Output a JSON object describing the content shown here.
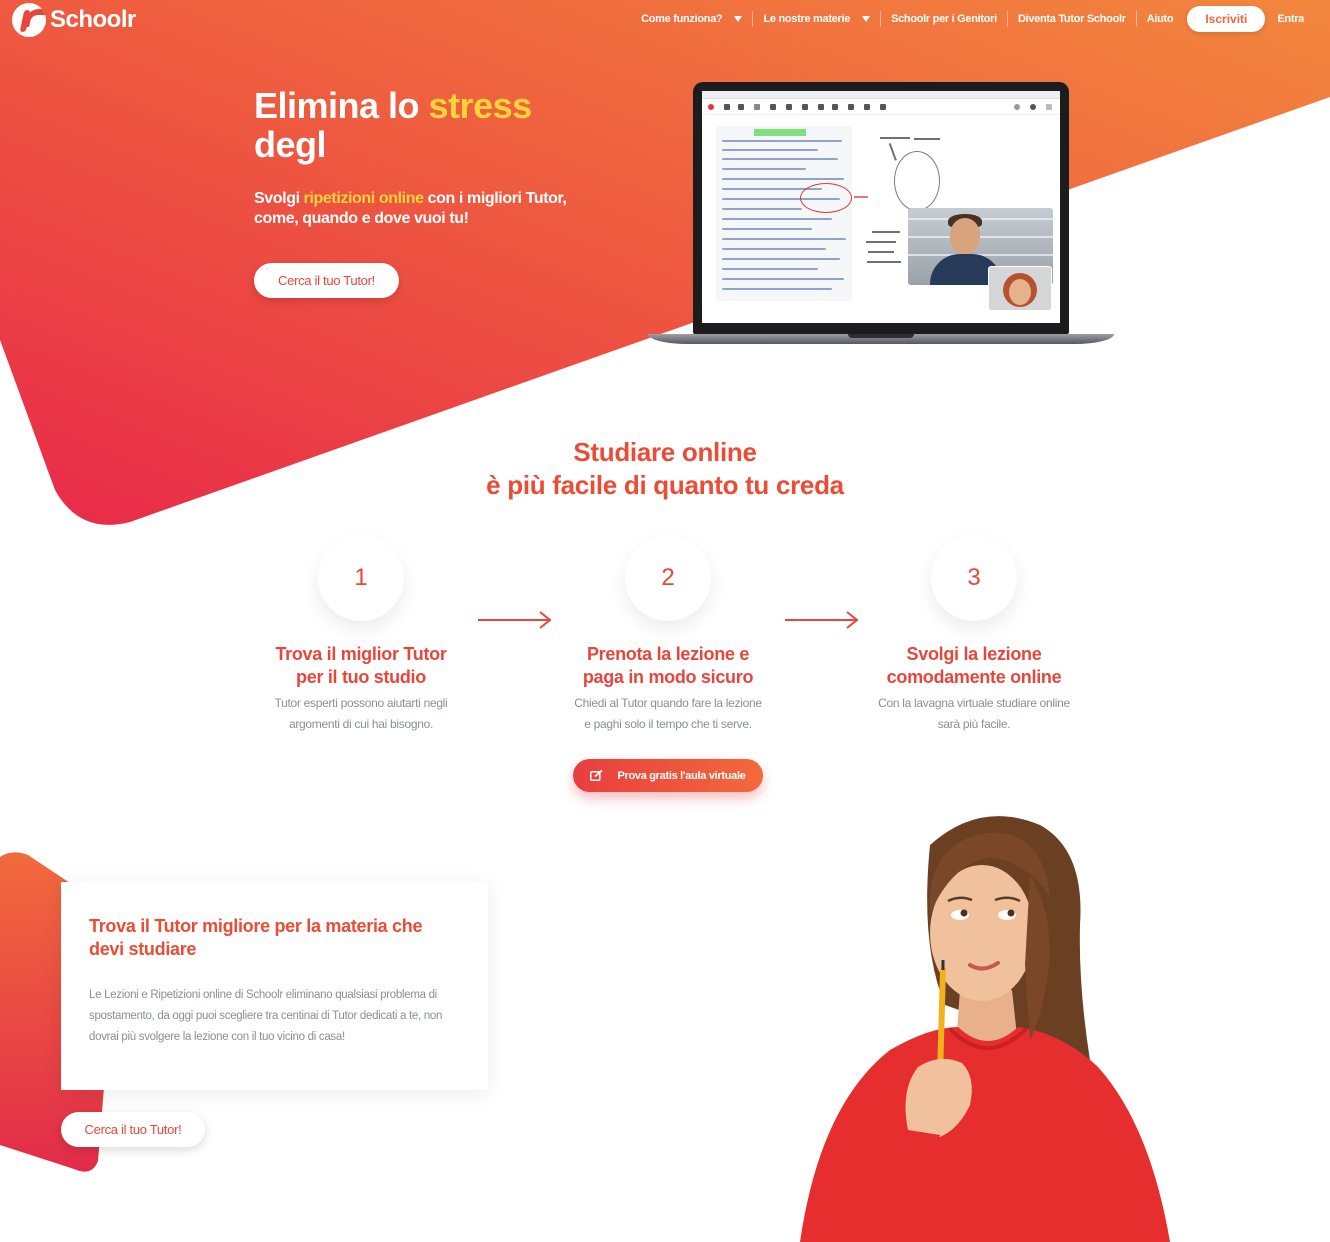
{
  "brand": {
    "name": "Schoolr"
  },
  "nav": {
    "items": [
      {
        "label": "Come funziona?",
        "dropdown": true
      },
      {
        "label": "Le nostre materie",
        "dropdown": true
      },
      {
        "label": "Schoolr per i Genitori",
        "dropdown": false
      },
      {
        "label": "Diventa Tutor Schoolr",
        "dropdown": false
      },
      {
        "label": "Aiuto",
        "dropdown": false
      }
    ],
    "signup": "Iscriviti",
    "login": "Entra"
  },
  "hero": {
    "title_part1": "Elimina lo ",
    "title_highlight": "stress",
    "title_part2": "degl",
    "subtitle_part1": "Svolgi ",
    "subtitle_highlight": "ripetizioni online",
    "subtitle_part2": " con i migliori Tutor, come, quando e dove vuoi tu!",
    "button": "Cerca il tuo Tutor!"
  },
  "steps_section": {
    "title_line1": "Studiare online",
    "title_line2": "è più facile di quanto tu creda",
    "steps": [
      {
        "number": "1",
        "title_line1": "Trova il miglior Tutor",
        "title_line2": "per il tuo studio",
        "text_line1": "Tutor esperti possono aiutarti negli",
        "text_line2": "argomenti di cui hai bisogno."
      },
      {
        "number": "2",
        "title_line1": "Prenota la lezione e",
        "title_line2": "paga in modo sicuro",
        "text_line1": "Chiedi al Tutor quando fare la lezione",
        "text_line2": "e paghi solo il tempo che ti serve."
      },
      {
        "number": "3",
        "title_line1": "Svolgi la lezione",
        "title_line2": "comodamente online",
        "text_line1": "Con la lavagna virtuale studiare online",
        "text_line2": "sarà più facile."
      }
    ],
    "cta": "Prova gratis l'aula virtuale"
  },
  "tutor_section": {
    "title": "Trova il Tutor migliore per la materia che devi studiare",
    "text": "Le Lezioni e Ripetizioni online di Schoolr eliminano qualsiasi problema di spostamento, da oggi puoi scegliere tra centinai di Tutor dedicati a te, non dovrai più svolgere la lezione con il tuo vicino di casa!",
    "button": "Cerca il tuo Tutor!"
  },
  "colors": {
    "accent": "#e8453c",
    "highlight": "#ffd43a",
    "gradient_start": "#e8294a",
    "gradient_end": "#f3873e"
  }
}
